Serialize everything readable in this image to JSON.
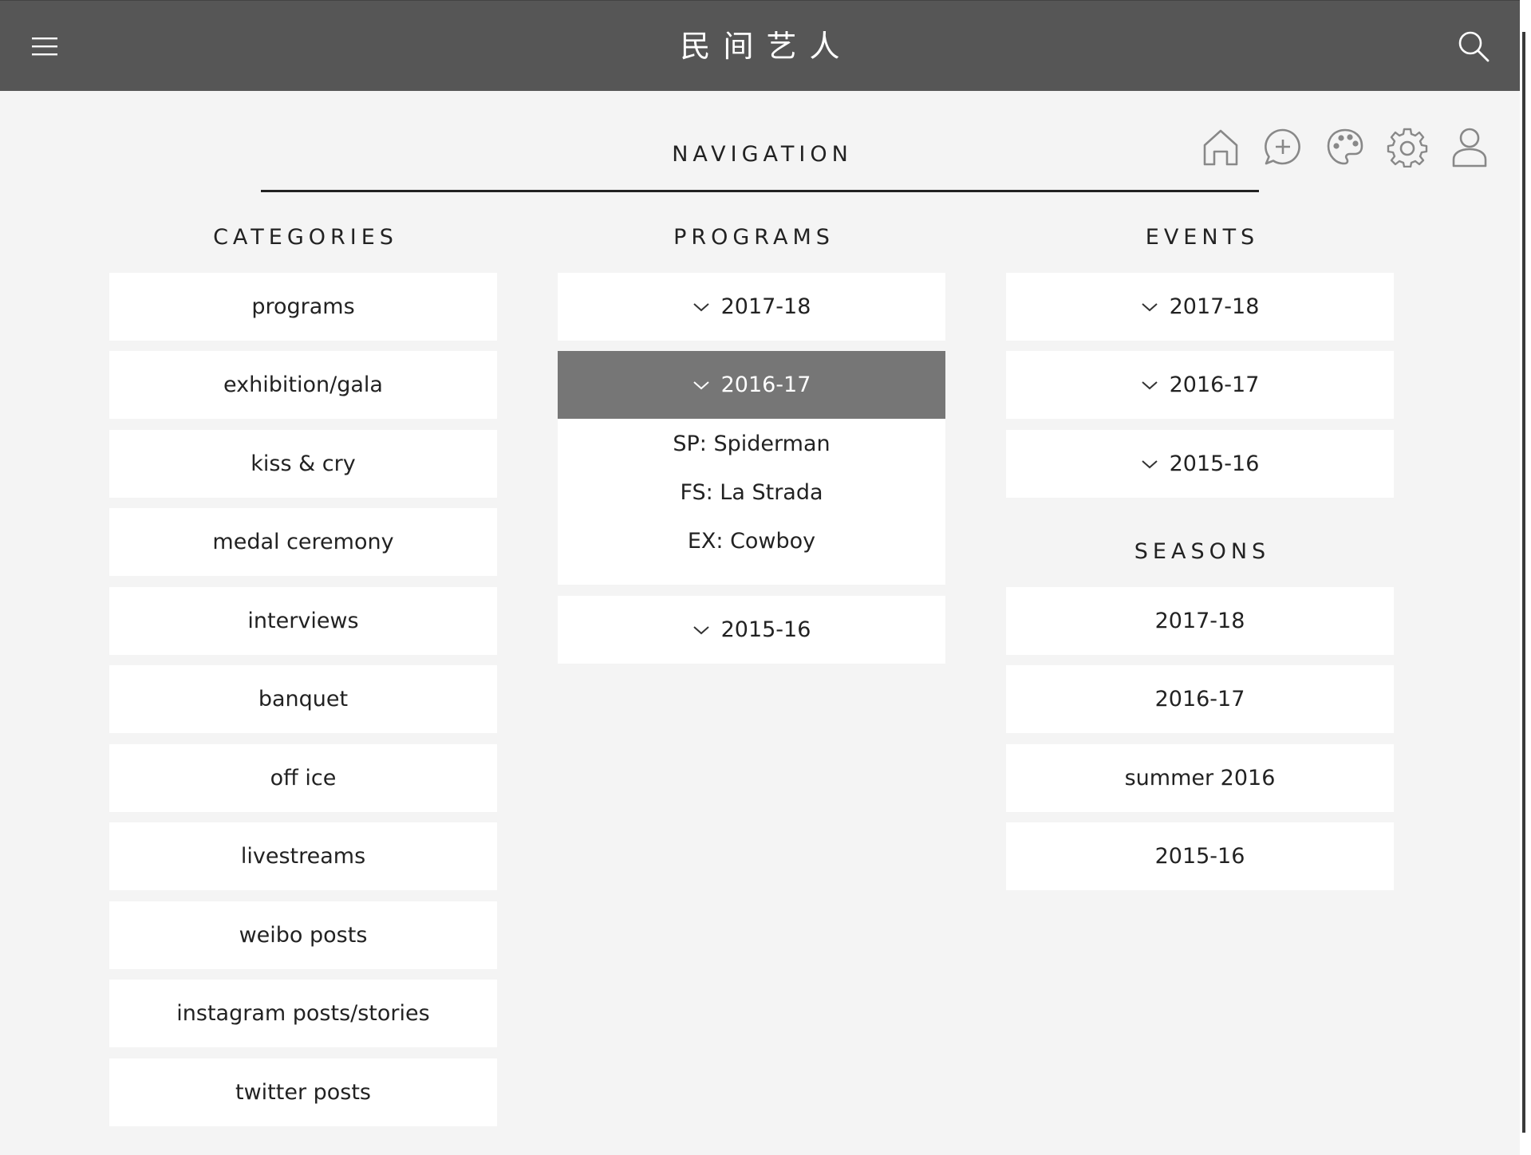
{
  "header": {
    "title": "民间艺人",
    "menu_icon": "hamburger-menu-icon",
    "search_icon": "search-icon"
  },
  "toolbar": {
    "icons": [
      "home-icon",
      "add-comment-icon",
      "palette-icon",
      "gear-icon",
      "user-icon"
    ]
  },
  "navigation": {
    "heading": "NAVIGATION"
  },
  "categories": {
    "heading": "CATEGORIES",
    "items": [
      "programs",
      "exhibition/gala",
      "kiss & cry",
      "medal ceremony",
      "interviews",
      "banquet",
      "off ice",
      "livestreams",
      "weibo posts",
      "instagram posts/stories",
      "twitter posts"
    ]
  },
  "programs": {
    "heading": "PROGRAMS",
    "items": [
      {
        "label": "2017-18",
        "expanded": false
      },
      {
        "label": "2016-17",
        "expanded": true,
        "children": [
          "SP: Spiderman",
          "FS: La Strada",
          "EX: Cowboy"
        ]
      },
      {
        "label": "2015-16",
        "expanded": false
      }
    ]
  },
  "events": {
    "heading": "EVENTS",
    "items": [
      "2017-18",
      "2016-17",
      "2015-16"
    ]
  },
  "seasons": {
    "heading": "SEASONS",
    "items": [
      "2017-18",
      "2016-17",
      "summer 2016",
      "2015-16"
    ]
  },
  "colors": {
    "header_bg": "#565656",
    "page_bg": "#f4f4f4",
    "card_bg": "#ffffff",
    "active_bg": "#767676"
  }
}
